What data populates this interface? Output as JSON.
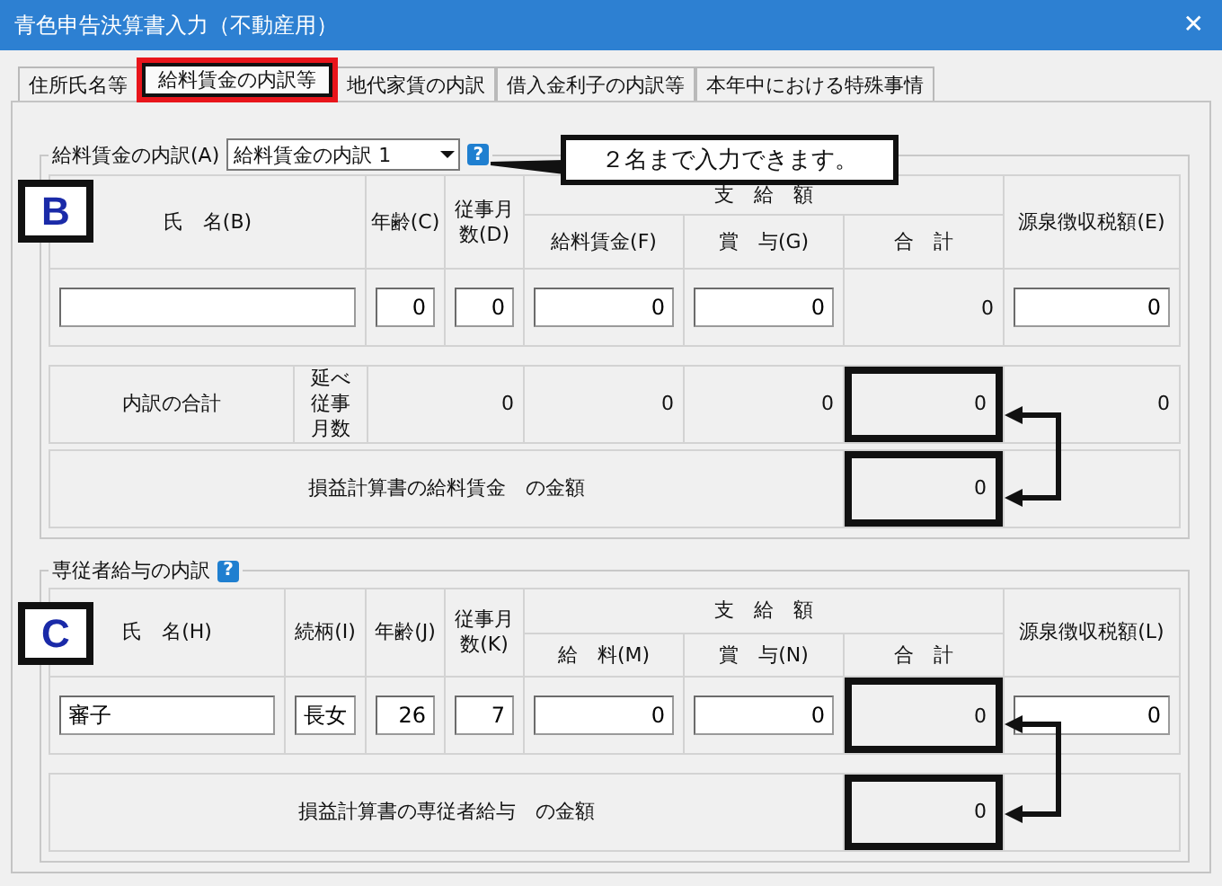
{
  "window": {
    "title": "青色申告決算書入力（不動産用）",
    "close": "✕"
  },
  "tabs": [
    {
      "label": "住所氏名等",
      "selected": false,
      "highlight": false
    },
    {
      "label": "給料賃金の内訳等",
      "selected": true,
      "highlight": true
    },
    {
      "label": "地代家賃の内訳",
      "selected": false,
      "highlight": false
    },
    {
      "label": "借入金利子の内訳等",
      "selected": false,
      "highlight": false
    },
    {
      "label": "本年中における特殊事情",
      "selected": false,
      "highlight": false
    }
  ],
  "callout": {
    "text": "２名まで入力できます。"
  },
  "sections": [
    {
      "marker": "B",
      "legend": "給料賃金の内訳(A)",
      "dropdown": {
        "value": "給料賃金の内訳 1"
      },
      "help": "?",
      "group_header": "支　給　額",
      "columns": [
        {
          "kind": "name",
          "label": "氏　名(B)",
          "grouped": false
        },
        {
          "kind": "age",
          "label": "年齢(C)",
          "grouped": false
        },
        {
          "kind": "months",
          "label": "従事月数(D)",
          "grouped": false
        },
        {
          "kind": "salary",
          "label": "給料賃金(F)",
          "grouped": true
        },
        {
          "kind": "bonus",
          "label": "賞　与(G)",
          "grouped": true
        },
        {
          "kind": "total",
          "label": "合　計",
          "grouped": true
        },
        {
          "kind": "tax",
          "label": "源泉徴収税額(E)",
          "grouped": false
        }
      ],
      "row": [
        {
          "kind": "input",
          "highlight": false
        },
        {
          "kind": "input",
          "value": "0",
          "highlight": false
        },
        {
          "kind": "input",
          "value": "0",
          "highlight": false
        },
        {
          "kind": "input",
          "value": "0",
          "highlight": false
        },
        {
          "kind": "input",
          "value": "0",
          "highlight": false
        },
        {
          "kind": "text",
          "value": "0",
          "highlight": false
        },
        {
          "kind": "input",
          "value": "0",
          "highlight": false
        }
      ],
      "summary": [
        {
          "label": "内訳の合計",
          "sublabel": "延べ従事月数",
          "values": [
            {
              "kind": "months",
              "text": "0",
              "highlight": false
            },
            {
              "kind": "salary",
              "text": "0",
              "highlight": false
            },
            {
              "kind": "bonus",
              "text": "0",
              "highlight": false
            },
            {
              "kind": "total",
              "text": "0",
              "highlight": true
            },
            {
              "kind": "tax",
              "text": "0",
              "highlight": false
            }
          ]
        },
        {
          "label": "損益計算書の給料賃金　の金額",
          "values": [
            {
              "kind": "total",
              "text": "0",
              "highlight": true
            }
          ]
        }
      ]
    },
    {
      "marker": "C",
      "legend": "専従者給与の内訳",
      "help": "?",
      "group_header": "支　給　額",
      "columns": [
        {
          "kind": "name",
          "label": "氏　名(H)",
          "grouped": false
        },
        {
          "kind": "relation",
          "label": "続柄(I)",
          "grouped": false
        },
        {
          "kind": "age",
          "label": "年齢(J)",
          "grouped": false
        },
        {
          "kind": "months",
          "label": "従事月数(K)",
          "grouped": false
        },
        {
          "kind": "salary",
          "label": "給　料(M)",
          "grouped": true
        },
        {
          "kind": "bonus",
          "label": "賞　与(N)",
          "grouped": true
        },
        {
          "kind": "total",
          "label": "合　計",
          "grouped": true
        },
        {
          "kind": "tax",
          "label": "源泉徴収税額(L)",
          "grouped": false
        }
      ],
      "row": [
        {
          "kind": "input",
          "value": "審子",
          "highlight": false
        },
        {
          "kind": "input",
          "value": "長女",
          "highlight": false
        },
        {
          "kind": "input",
          "value": "26",
          "highlight": false
        },
        {
          "kind": "input",
          "value": "7",
          "highlight": false
        },
        {
          "kind": "input",
          "value": "0",
          "highlight": false
        },
        {
          "kind": "input",
          "value": "0",
          "highlight": false
        },
        {
          "kind": "text",
          "value": "0",
          "highlight": true
        },
        {
          "kind": "input",
          "value": "0",
          "highlight": false
        }
      ],
      "summary": [
        {
          "label": "損益計算書の専従者給与　の金額",
          "values": [
            {
              "kind": "total",
              "text": "0",
              "highlight": true
            }
          ]
        }
      ]
    }
  ]
}
